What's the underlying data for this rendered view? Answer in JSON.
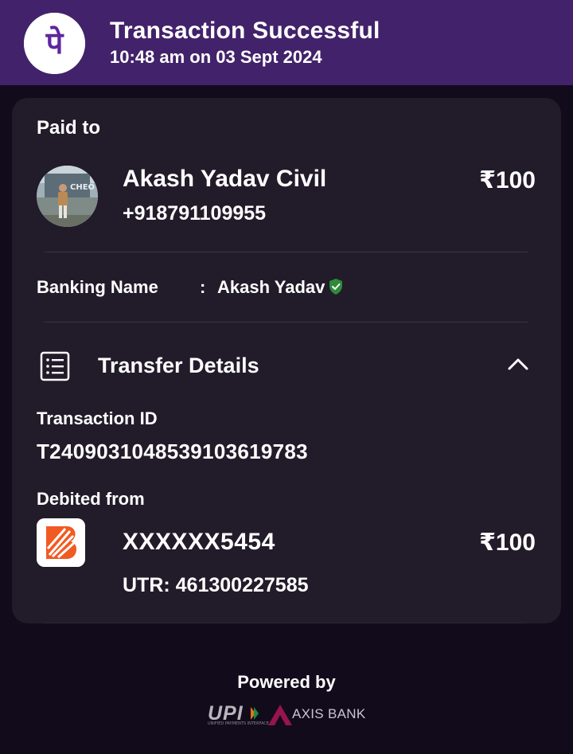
{
  "header": {
    "logo_glyph": "पे",
    "title": "Transaction Successful",
    "subtitle": "10:48 am on 03 Sept 2024",
    "background_color": "#42226a",
    "logo_color": "#5f259f"
  },
  "paid_to": {
    "label": "Paid to",
    "name": "Akash Yadav Civil",
    "phone": "+918791109955",
    "amount": "₹100"
  },
  "banking": {
    "label": "Banking Name",
    "separator": ":",
    "value": "Akash Yadav",
    "verified_icon": "verified-shield-icon",
    "verified_color": "#2e8b3a"
  },
  "transfer_details": {
    "title": "Transfer Details",
    "icon": "receipt-list-icon",
    "toggle_icon": "chevron-up-icon",
    "transaction_id_label": "Transaction ID",
    "transaction_id": "T2409031048539103619783",
    "debited_from_label": "Debited from",
    "account": "XXXXXX5454",
    "amount": "₹100",
    "utr": "UTR: 461300227585",
    "bank_icon": "bank-of-baroda-logo",
    "bank_color": "#f15a22"
  },
  "footer": {
    "powered_by": "Powered by",
    "upi_text": "UPI",
    "upi_tagline": "UNIFIED PAYMENTS INTERFACE",
    "axis_text": "AXIS BANK",
    "axis_color": "#97144d"
  }
}
